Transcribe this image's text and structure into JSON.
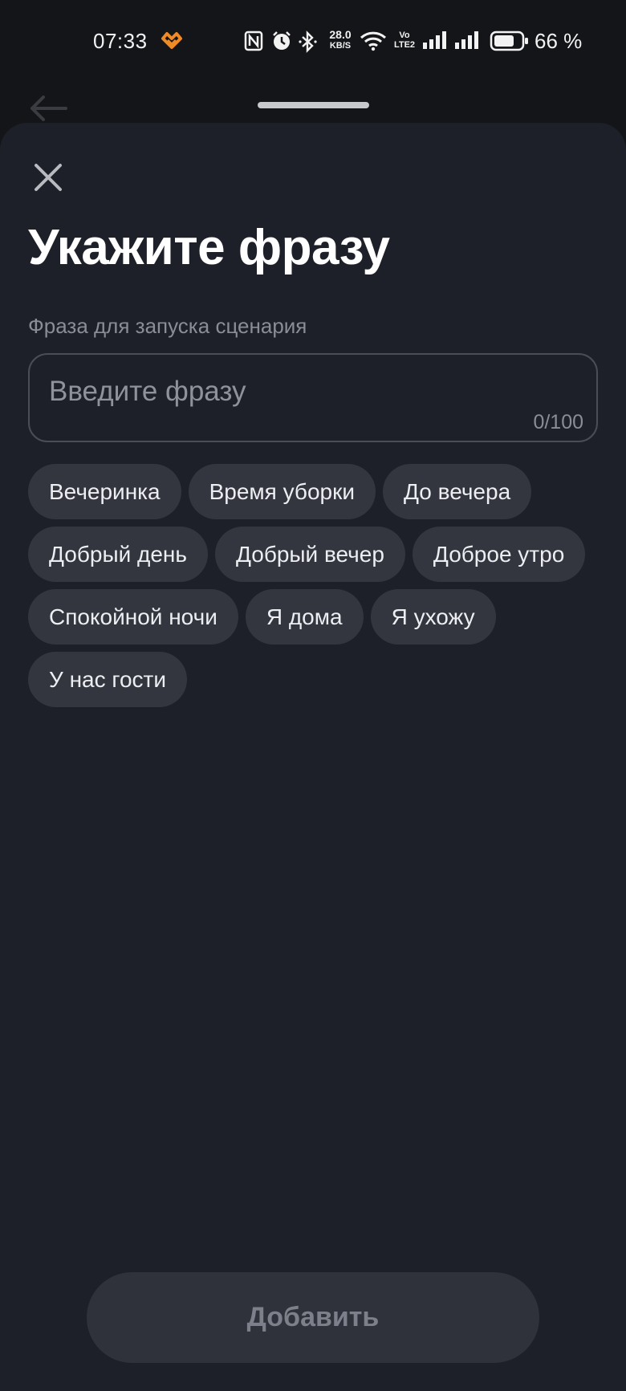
{
  "status_bar": {
    "time": "07:33",
    "net_speed_value": "28.0",
    "net_speed_unit": "KB/S",
    "volte_line1": "Vo",
    "volte_line2": "LTE2",
    "battery_percent": "66 %",
    "icons": [
      "app-notification-icon",
      "nfc-icon",
      "alarm-icon",
      "bluetooth-icon",
      "wifi-icon",
      "signal-sim1-icon",
      "signal-sim2-icon",
      "battery-icon"
    ]
  },
  "sheet": {
    "title": "Укажите фразу",
    "field_label": "Фраза для запуска сценария",
    "input_placeholder": "Введите фразу",
    "input_value": "",
    "counter": "0/100",
    "suggestions": [
      "Вечеринка",
      "Время уборки",
      "До вечера",
      "Добрый день",
      "Добрый вечер",
      "Доброе утро",
      "Спокойной ночи",
      "Я дома",
      "Я ухожу",
      "У нас гости"
    ],
    "add_button": "Добавить"
  },
  "colors": {
    "background": "#141518",
    "sheet": "#1e2029",
    "chip": "#33363f",
    "button_disabled": "#2f323b",
    "app_icon_accent": "#f08a24"
  }
}
